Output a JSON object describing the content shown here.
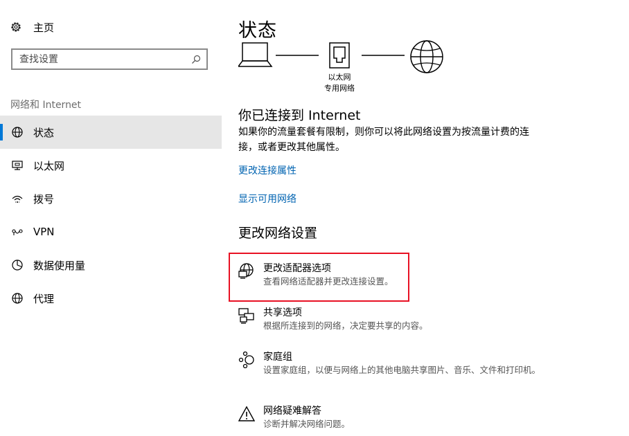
{
  "sidebar": {
    "home_label": "主页",
    "search_placeholder": "查找设置",
    "section_label": "网络和 Internet",
    "items": [
      {
        "label": "状态",
        "icon": "globe-icon",
        "active": true
      },
      {
        "label": "以太网",
        "icon": "ethernet-icon"
      },
      {
        "label": "拨号",
        "icon": "dialup-icon"
      },
      {
        "label": "VPN",
        "icon": "vpn-icon"
      },
      {
        "label": "数据使用量",
        "icon": "data-usage-icon"
      },
      {
        "label": "代理",
        "icon": "globe-icon"
      }
    ]
  },
  "main": {
    "title": "状态",
    "diagram": {
      "adapter_label_line1": "以太网",
      "adapter_label_line2": "专用网络"
    },
    "connection_title": "你已连接到 Internet",
    "connection_desc": "如果你的流量套餐有限制，则你可以将此网络设置为按流量计费的连接，或者更改其他属性。",
    "links": {
      "change_properties": "更改连接属性",
      "show_networks": "显示可用网络"
    },
    "change_settings_title": "更改网络设置",
    "options": [
      {
        "title": "更改适配器选项",
        "desc": "查看网络适配器并更改连接设置。",
        "icon": "adapter-icon"
      },
      {
        "title": "共享选项",
        "desc": "根据所连接到的网络，决定要共享的内容。",
        "icon": "sharing-icon"
      },
      {
        "title": "家庭组",
        "desc": "设置家庭组，以便与网络上的其他电脑共享图片、音乐、文件和打印机。",
        "icon": "homegroup-icon"
      },
      {
        "title": "网络疑难解答",
        "desc": "诊断并解决网络问题。",
        "icon": "warning-icon"
      }
    ]
  },
  "colors": {
    "accent": "#0078d7",
    "link": "#0063b1",
    "highlight": "#e81123",
    "active_bg": "#e6e6e6"
  }
}
